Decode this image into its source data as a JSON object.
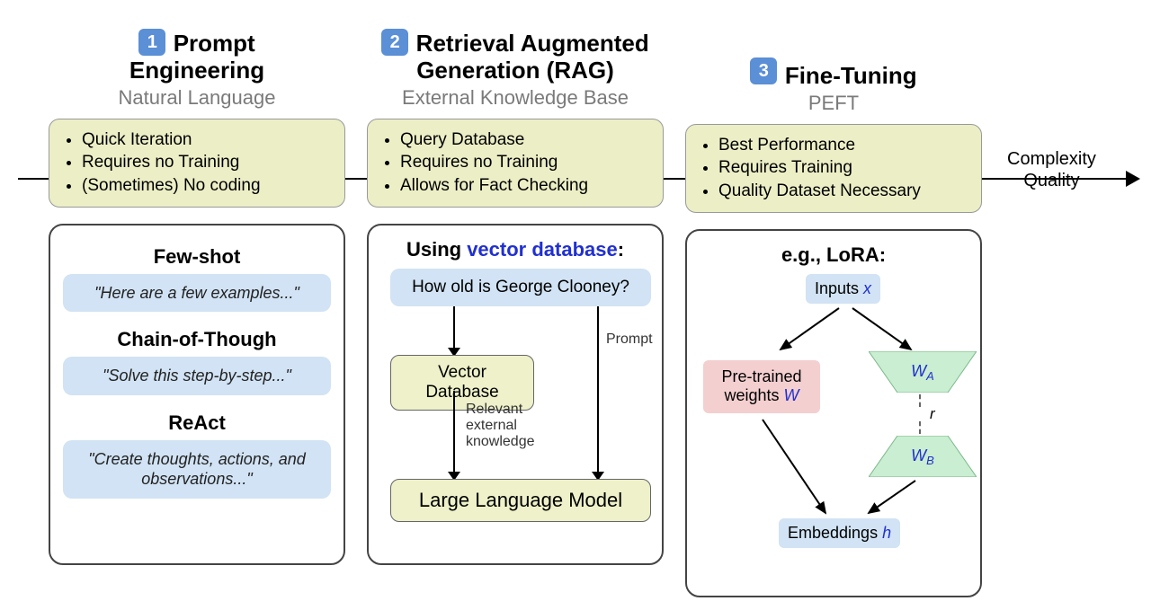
{
  "axis": {
    "label1": "Complexity",
    "label2": "Quality"
  },
  "col1": {
    "num": "1",
    "title": "Prompt Engineering",
    "subtitle": "Natural Language",
    "bullets": [
      "Quick Iteration",
      "Requires no Training",
      "(Sometimes) No coding"
    ],
    "methods": [
      {
        "name": "Few-shot",
        "example": "\"Here are a few examples...\""
      },
      {
        "name": "Chain-of-Though",
        "example": "\"Solve this step-by-step...\""
      },
      {
        "name": "ReAct",
        "example": "\"Create thoughts, actions, and observations...\""
      }
    ]
  },
  "col2": {
    "num": "2",
    "title": "Retrieval Augmented Generation (RAG)",
    "subtitle": "External Knowledge Base",
    "bullets": [
      "Query Database",
      "Requires no Training",
      "Allows for Fact Checking"
    ],
    "detail_prefix": "Using ",
    "detail_vdb": "vector database",
    "detail_suffix": ":",
    "question": "How old is George Clooney?",
    "vdb_label": "Vector Database",
    "prompt_label": "Prompt",
    "knowledge_label": "Relevant external knowledge",
    "llm_label": "Large Language Model"
  },
  "col3": {
    "num": "3",
    "title": "Fine-Tuning",
    "subtitle": "PEFT",
    "bullets": [
      "Best Performance",
      "Requires Training",
      "Quality Dataset Necessary"
    ],
    "detail_title": "e.g., LoRA:",
    "inputs_label": "Inputs ",
    "inputs_var": "x",
    "pretrained_label": "Pre-trained weights ",
    "pretrained_var": "W",
    "wa": "W",
    "wa_sub": "A",
    "r": "r",
    "wb": "W",
    "wb_sub": "B",
    "emb_label": "Embeddings ",
    "emb_var": "h"
  }
}
